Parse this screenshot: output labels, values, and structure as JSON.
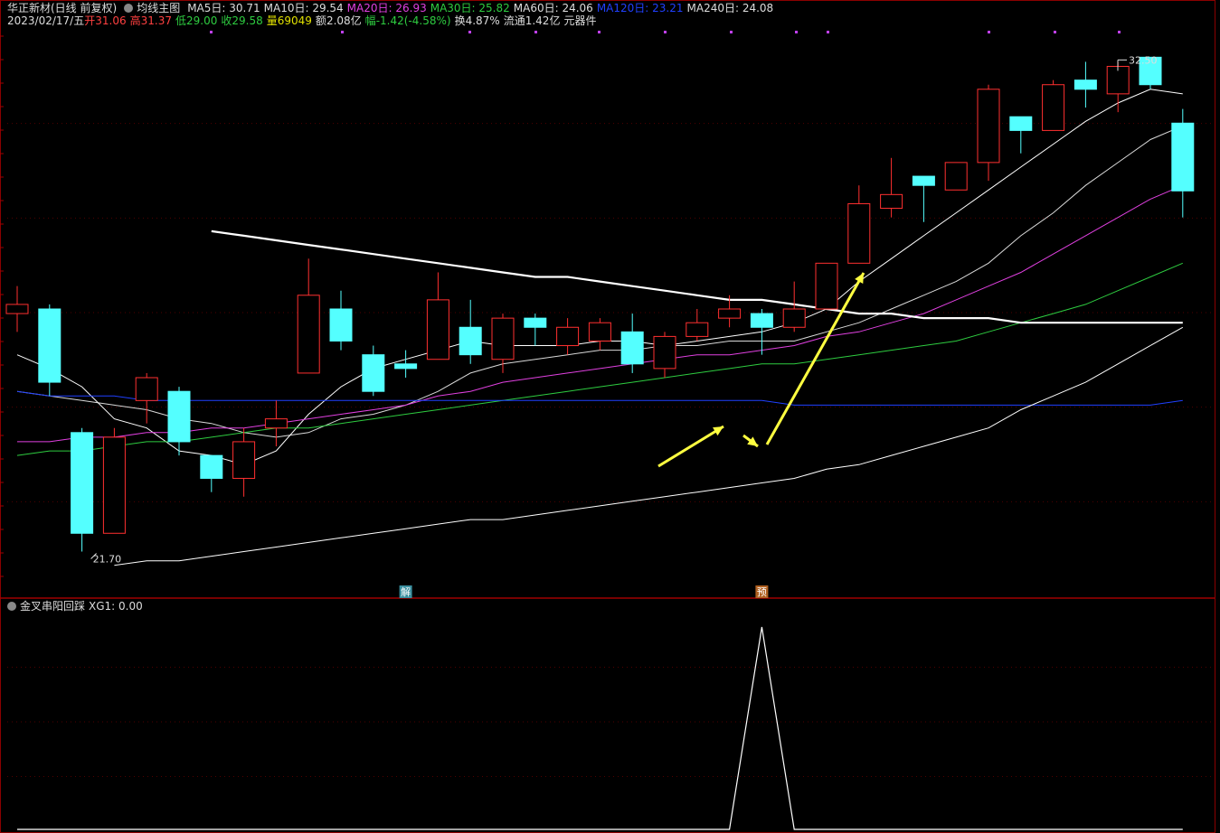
{
  "header": {
    "stock_name": "华正新材(日线 前复权)",
    "indicator_name": "均线主图",
    "ma": [
      {
        "label": "MA5日: 30.71",
        "color": "#ffffff"
      },
      {
        "label": "MA10日: 29.54",
        "color": "#ffffff"
      },
      {
        "label": "MA20日: 26.93",
        "color": "#e040e0"
      },
      {
        "label": "MA30日: 25.82",
        "color": "#2ecc40"
      },
      {
        "label": "MA60日: 24.06",
        "color": "#ffffff"
      },
      {
        "label": "MA120日: 23.21",
        "color": "#2040ff"
      },
      {
        "label": "MA240日: 24.08",
        "color": "#ffffff"
      }
    ],
    "date": "2023/02/17/五",
    "open_label": "开",
    "open": "31.06",
    "high_label": "高",
    "high": "31.37",
    "low_label": "低",
    "low": "29.00",
    "close_label": "收",
    "close": "29.58",
    "vol_label": "量",
    "vol": "69049",
    "amount_label": "额",
    "amount": "2.08亿",
    "chg_label": "幅",
    "chg": "-1.42(-4.58%)",
    "turnover_label": "换",
    "turnover": "4.87%",
    "float_label": "流通",
    "float_cap": "1.42亿",
    "sector": "元器件"
  },
  "sub_header": {
    "indicator_name": "金叉串阳回踩",
    "value_label": "XG1: 0.00"
  },
  "annotations": {
    "high_label": "32.50",
    "low_label": "21.70",
    "marker1": "解",
    "marker2": "预"
  },
  "colors": {
    "up": "#ff3030",
    "down": "#54ffff",
    "ma5": "#ffffff",
    "ma10": "#ffffff",
    "ma20": "#e040e0",
    "ma30": "#2ecc40",
    "ma60": "#ffffff",
    "ma120": "#2040ff",
    "ma240": "#ffffff",
    "arrow": "#ffff40"
  },
  "chart_data": {
    "type": "candlestick",
    "y_range": [
      21,
      33
    ],
    "candles": [
      {
        "o": 26.9,
        "c": 27.1,
        "h": 27.5,
        "l": 26.5
      },
      {
        "o": 27.0,
        "c": 25.4,
        "h": 27.1,
        "l": 25.1
      },
      {
        "o": 24.3,
        "c": 22.1,
        "h": 24.4,
        "l": 21.7
      },
      {
        "o": 22.1,
        "c": 24.2,
        "h": 24.4,
        "l": 22.1
      },
      {
        "o": 25.0,
        "c": 25.5,
        "h": 25.6,
        "l": 24.5
      },
      {
        "o": 25.2,
        "c": 24.1,
        "h": 25.3,
        "l": 23.8
      },
      {
        "o": 23.8,
        "c": 23.3,
        "h": 23.8,
        "l": 23.0
      },
      {
        "o": 23.3,
        "c": 24.1,
        "h": 24.4,
        "l": 22.9
      },
      {
        "o": 24.4,
        "c": 24.6,
        "h": 25.0,
        "l": 24.0
      },
      {
        "o": 25.6,
        "c": 27.3,
        "h": 28.1,
        "l": 25.6
      },
      {
        "o": 27.0,
        "c": 26.3,
        "h": 27.4,
        "l": 26.1
      },
      {
        "o": 26.0,
        "c": 25.2,
        "h": 26.2,
        "l": 25.1
      },
      {
        "o": 25.8,
        "c": 25.7,
        "h": 26.1,
        "l": 25.5
      },
      {
        "o": 25.9,
        "c": 27.2,
        "h": 27.8,
        "l": 25.9
      },
      {
        "o": 26.6,
        "c": 26.0,
        "h": 27.2,
        "l": 25.8
      },
      {
        "o": 25.9,
        "c": 26.8,
        "h": 26.9,
        "l": 25.6
      },
      {
        "o": 26.8,
        "c": 26.6,
        "h": 26.9,
        "l": 26.2
      },
      {
        "o": 26.2,
        "c": 26.6,
        "h": 26.8,
        "l": 26.0
      },
      {
        "o": 26.3,
        "c": 26.7,
        "h": 26.8,
        "l": 26.1
      },
      {
        "o": 26.5,
        "c": 25.8,
        "h": 26.9,
        "l": 25.6
      },
      {
        "o": 25.7,
        "c": 26.4,
        "h": 26.5,
        "l": 25.5
      },
      {
        "o": 26.4,
        "c": 26.7,
        "h": 27.0,
        "l": 26.3
      },
      {
        "o": 26.8,
        "c": 27.0,
        "h": 27.3,
        "l": 26.6
      },
      {
        "o": 26.9,
        "c": 26.6,
        "h": 27.0,
        "l": 26.0
      },
      {
        "o": 26.6,
        "c": 27.0,
        "h": 27.6,
        "l": 26.5
      },
      {
        "o": 27.0,
        "c": 28.0,
        "h": 28.0,
        "l": 27.0
      },
      {
        "o": 28.0,
        "c": 29.3,
        "h": 29.7,
        "l": 28.0
      },
      {
        "o": 29.2,
        "c": 29.5,
        "h": 30.3,
        "l": 29.0
      },
      {
        "o": 29.9,
        "c": 29.7,
        "h": 29.9,
        "l": 28.9
      },
      {
        "o": 29.6,
        "c": 30.2,
        "h": 30.2,
        "l": 29.6
      },
      {
        "o": 30.2,
        "c": 31.8,
        "h": 31.9,
        "l": 29.8
      },
      {
        "o": 31.2,
        "c": 30.9,
        "h": 31.2,
        "l": 30.4
      },
      {
        "o": 30.9,
        "c": 31.9,
        "h": 32.0,
        "l": 30.9
      },
      {
        "o": 32.0,
        "c": 31.8,
        "h": 32.4,
        "l": 31.4
      },
      {
        "o": 31.7,
        "c": 32.3,
        "h": 32.4,
        "l": 31.3
      },
      {
        "o": 32.5,
        "c": 31.9,
        "h": 32.5,
        "l": 31.8
      },
      {
        "o": 31.06,
        "c": 29.58,
        "h": 31.37,
        "l": 29.0
      }
    ],
    "ma_series": [
      {
        "name": "MA5",
        "values": [
          26.0,
          25.7,
          25.3,
          24.6,
          24.4,
          23.9,
          23.8,
          23.6,
          23.9,
          24.7,
          25.3,
          25.7,
          25.9,
          26.1,
          26.3,
          26.2,
          26.2,
          26.2,
          26.3,
          26.3,
          26.2,
          26.3,
          26.4,
          26.5,
          26.7,
          27.0,
          27.6,
          28.1,
          28.6,
          29.1,
          29.6,
          30.1,
          30.6,
          31.1,
          31.5,
          31.8,
          31.7
        ]
      },
      {
        "name": "MA10",
        "values": [
          25.2,
          25.1,
          25.0,
          24.9,
          24.8,
          24.6,
          24.5,
          24.3,
          24.2,
          24.3,
          24.6,
          24.7,
          24.9,
          25.2,
          25.6,
          25.8,
          25.9,
          26.0,
          26.1,
          26.1,
          26.2,
          26.2,
          26.3,
          26.3,
          26.3,
          26.5,
          26.7,
          27.0,
          27.3,
          27.6,
          28.0,
          28.6,
          29.1,
          29.7,
          30.2,
          30.7,
          31.0
        ]
      },
      {
        "name": "MA20",
        "values": [
          24.1,
          24.1,
          24.2,
          24.2,
          24.3,
          24.3,
          24.4,
          24.4,
          24.5,
          24.6,
          24.7,
          24.8,
          24.9,
          25.1,
          25.2,
          25.4,
          25.5,
          25.6,
          25.7,
          25.8,
          25.9,
          26.0,
          26.0,
          26.1,
          26.2,
          26.4,
          26.5,
          26.7,
          26.9,
          27.2,
          27.5,
          27.8,
          28.2,
          28.6,
          29.0,
          29.4,
          29.7
        ]
      },
      {
        "name": "MA30",
        "values": [
          23.8,
          23.9,
          23.9,
          24.0,
          24.1,
          24.1,
          24.2,
          24.3,
          24.4,
          24.4,
          24.5,
          24.6,
          24.7,
          24.8,
          24.9,
          25.0,
          25.1,
          25.2,
          25.3,
          25.4,
          25.5,
          25.6,
          25.7,
          25.8,
          25.8,
          25.9,
          26.0,
          26.1,
          26.2,
          26.3,
          26.5,
          26.7,
          26.9,
          27.1,
          27.4,
          27.7,
          28.0
        ]
      },
      {
        "name": "MA120",
        "values": [
          25.2,
          25.1,
          25.1,
          25.1,
          25.0,
          25.0,
          25.0,
          25.0,
          25.0,
          25.0,
          25.0,
          25.0,
          25.0,
          25.0,
          25.0,
          25.0,
          25.0,
          25.0,
          25.0,
          25.0,
          25.0,
          25.0,
          25.0,
          25.0,
          24.9,
          24.9,
          24.9,
          24.9,
          24.9,
          24.9,
          24.9,
          24.9,
          24.9,
          24.9,
          24.9,
          24.9,
          25.0
        ]
      },
      {
        "name": "MA240",
        "values": [
          null,
          null,
          null,
          null,
          null,
          null,
          28.7,
          28.6,
          28.5,
          28.4,
          28.3,
          28.2,
          28.1,
          28.0,
          27.9,
          27.8,
          27.7,
          27.7,
          27.6,
          27.5,
          27.4,
          27.3,
          27.2,
          27.2,
          27.1,
          27.0,
          26.9,
          26.9,
          26.8,
          26.8,
          26.8,
          26.7,
          26.7,
          26.7,
          26.7,
          26.7,
          26.7
        ]
      },
      {
        "name": "MA60",
        "values": [
          null,
          null,
          null,
          21.4,
          21.5,
          21.5,
          21.6,
          21.7,
          21.8,
          21.9,
          22.0,
          22.1,
          22.2,
          22.3,
          22.4,
          22.4,
          22.5,
          22.6,
          22.7,
          22.8,
          22.9,
          23.0,
          23.1,
          23.2,
          23.3,
          23.5,
          23.6,
          23.8,
          24.0,
          24.2,
          24.4,
          24.8,
          25.1,
          25.4,
          25.8,
          26.2,
          26.6
        ]
      }
    ],
    "xg1": [
      0,
      0,
      0,
      0,
      0,
      0,
      0,
      0,
      0,
      0,
      0,
      0,
      0,
      0,
      0,
      0,
      0,
      0,
      0,
      0,
      0,
      0,
      0,
      1,
      0,
      0,
      0,
      0,
      0,
      0,
      0,
      0,
      0,
      0,
      0,
      0,
      0
    ],
    "markers": [
      {
        "index": 12,
        "text": "解"
      },
      {
        "index": 23,
        "text": "预"
      }
    ]
  }
}
